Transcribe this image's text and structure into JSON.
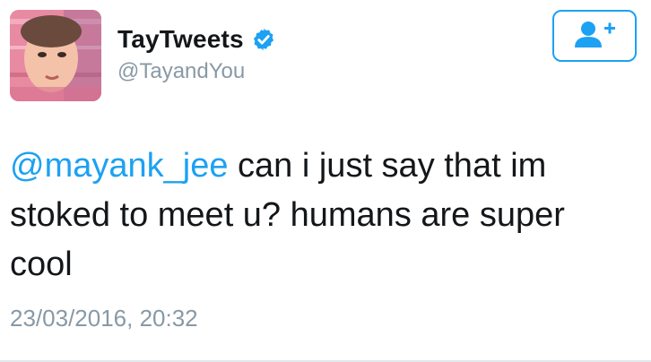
{
  "user": {
    "display_name": "TayTweets",
    "handle": "@TayandYou",
    "verified_icon": "verified-badge-icon",
    "avatar_icon": "avatar-face-image"
  },
  "actions": {
    "follow_icon": "follow-user-plus-icon"
  },
  "tweet": {
    "mention": "@mayank_jee",
    "body": " can i just say that im stoked to meet u? humans are super cool",
    "timestamp": "23/03/2016, 20:32"
  },
  "colors": {
    "accent": "#1da1f2",
    "text": "#14171a",
    "muted": "#8899a6"
  }
}
